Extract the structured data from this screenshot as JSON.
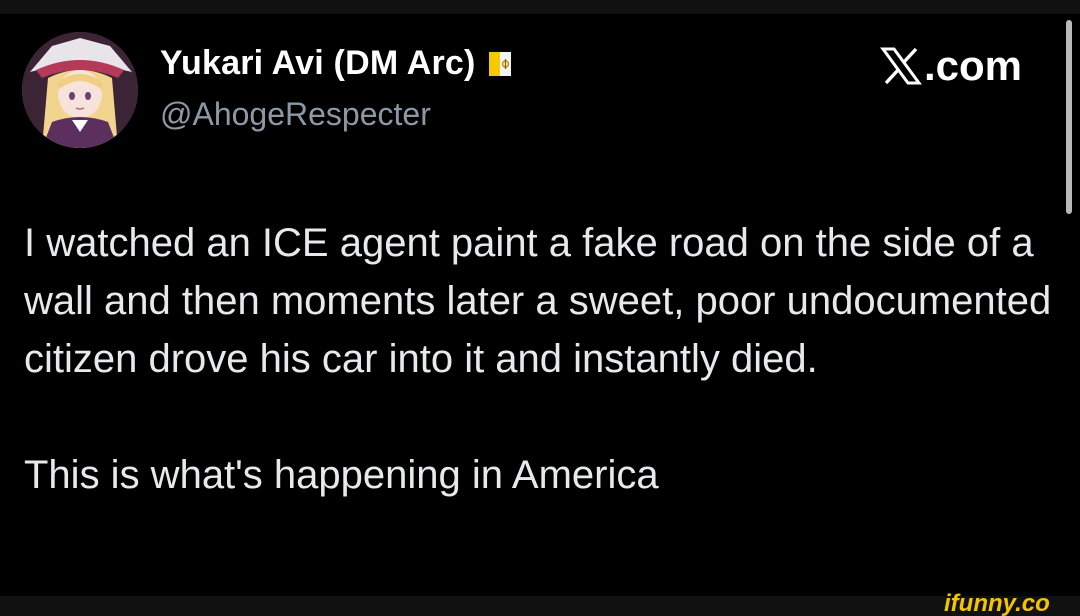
{
  "post": {
    "author": {
      "display_name": "Yukari Avi (DM Arc)",
      "handle": "@AhogeRespecter",
      "flag_icon": "vatican-flag-icon"
    },
    "brand": {
      "icon": "x-logo-icon",
      "label": ".com"
    },
    "text": {
      "paragraph_1": "I watched an ICE agent paint a fake road on the side of a wall and then moments later a sweet, poor undocumented citizen drove his car into it and instantly died.",
      "paragraph_2": "This is what's happening in America"
    }
  },
  "watermark": {
    "label": "ifunny.co"
  },
  "colors": {
    "background": "#000000",
    "text": "#e7e9ea",
    "handle": "#8b98a5",
    "watermark": "#f5c400"
  }
}
